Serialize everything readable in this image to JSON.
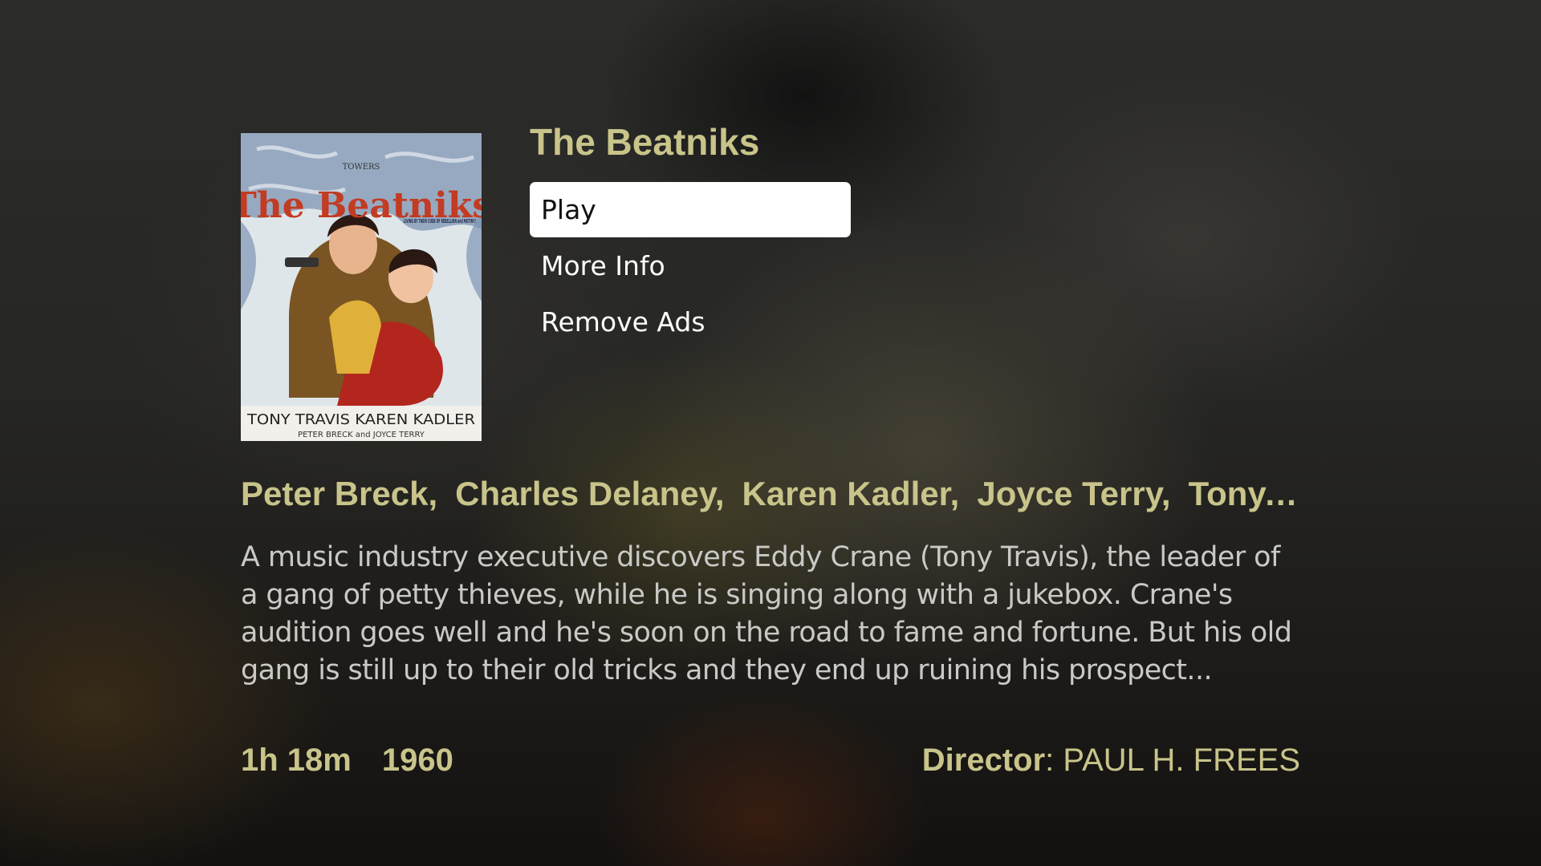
{
  "movie": {
    "title": "The Beatniks",
    "poster": {
      "title_text": "The Beatniks",
      "tagline": "LIVING BY THEIR CODE OF REBELLION and MUTINY!",
      "top_text": "TOWERS",
      "stars_line": "TONY TRAVIS KAREN KADLER",
      "costars_line": "PETER BRECK and JOYCE TERRY"
    },
    "cast": [
      "Peter Breck,",
      "Charles Delaney,",
      "Karen Kadler,",
      "Joyce Terry,",
      "Tony..."
    ],
    "description": "A music industry executive discovers Eddy Crane (Tony Travis), the leader of a gang of petty thieves, while he is singing along with a jukebox. Crane's audition goes well and he's soon on the road to fame and fortune. But his old gang is still up to their old tricks and they end up ruining his prospect...",
    "duration": "1h 18m",
    "year": "1960",
    "director_label": "Director",
    "director_sep": ": ",
    "director": "PAUL H. FREES"
  },
  "menu": {
    "items": [
      {
        "label": "Play",
        "selected": true
      },
      {
        "label": "More Info",
        "selected": false
      },
      {
        "label": "Remove Ads",
        "selected": false
      }
    ]
  },
  "colors": {
    "accent": "#c8c48a",
    "description_text": "#c9c9c6",
    "menu_text": "#ffffff",
    "selected_bg": "#ffffff",
    "selected_text": "#111111"
  }
}
